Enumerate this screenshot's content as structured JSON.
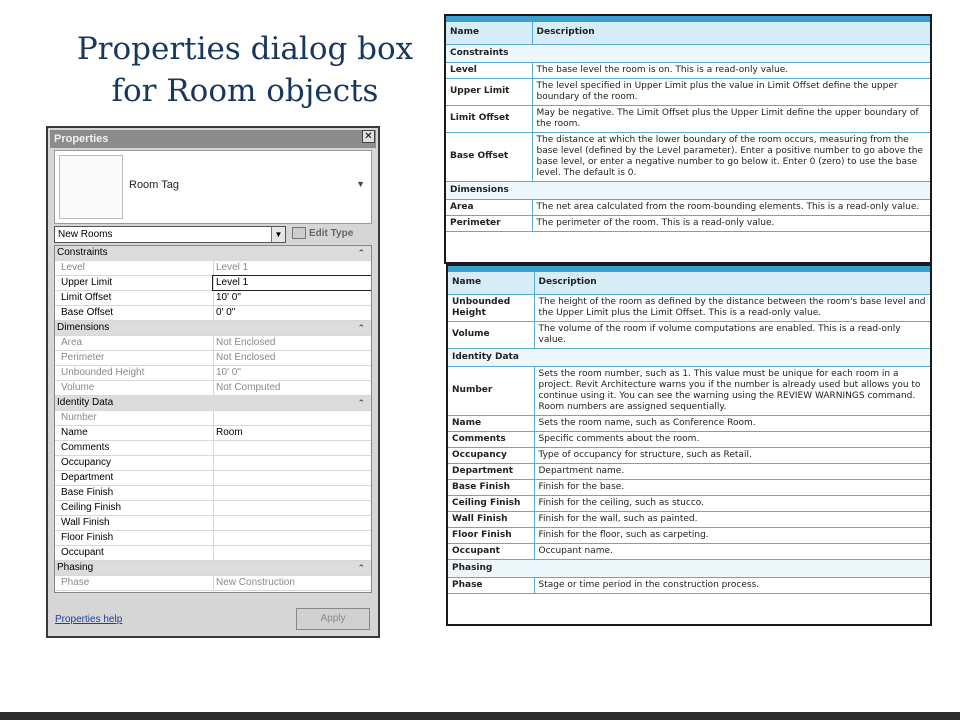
{
  "slide": {
    "title": "Properties dialog box for Room objects"
  },
  "dialog": {
    "title": "Properties",
    "close": "✕",
    "type_name": "Room Tag",
    "selector_value": "New Rooms",
    "edit_type": "Edit Type",
    "help_link": "Properties help",
    "apply": "Apply",
    "rows": [
      {
        "kind": "section",
        "label": "Constraints"
      },
      {
        "kind": "prop",
        "label": "Level",
        "value": "Level 1",
        "readonly": true
      },
      {
        "kind": "prop",
        "label": "Upper Limit",
        "value": "Level 1",
        "selected": true
      },
      {
        "kind": "prop",
        "label": "Limit Offset",
        "value": "10'  0\""
      },
      {
        "kind": "prop",
        "label": "Base Offset",
        "value": "0'  0\""
      },
      {
        "kind": "section",
        "label": "Dimensions"
      },
      {
        "kind": "prop",
        "label": "Area",
        "value": "Not Enclosed",
        "readonly": true
      },
      {
        "kind": "prop",
        "label": "Perimeter",
        "value": "Not Enclosed",
        "readonly": true
      },
      {
        "kind": "prop",
        "label": "Unbounded Height",
        "value": "10'  0\"",
        "readonly": true
      },
      {
        "kind": "prop",
        "label": "Volume",
        "value": "Not Computed",
        "readonly": true
      },
      {
        "kind": "section",
        "label": "Identity Data"
      },
      {
        "kind": "prop",
        "label": "Number",
        "value": "",
        "readonly": true
      },
      {
        "kind": "prop",
        "label": "Name",
        "value": "Room"
      },
      {
        "kind": "prop",
        "label": "Comments",
        "value": ""
      },
      {
        "kind": "prop",
        "label": "Occupancy",
        "value": ""
      },
      {
        "kind": "prop",
        "label": "Department",
        "value": ""
      },
      {
        "kind": "prop",
        "label": "Base Finish",
        "value": ""
      },
      {
        "kind": "prop",
        "label": "Ceiling Finish",
        "value": ""
      },
      {
        "kind": "prop",
        "label": "Wall Finish",
        "value": ""
      },
      {
        "kind": "prop",
        "label": "Floor Finish",
        "value": ""
      },
      {
        "kind": "prop",
        "label": "Occupant",
        "value": ""
      },
      {
        "kind": "section",
        "label": "Phasing"
      },
      {
        "kind": "prop",
        "label": "Phase",
        "value": "New Construction",
        "readonly": true
      }
    ]
  },
  "table1": {
    "headers": [
      "Name",
      "Description"
    ],
    "rows": [
      {
        "kind": "sub",
        "name": "Constraints"
      },
      {
        "name": "Level",
        "desc": "The base level the room is on. This is a read-only value."
      },
      {
        "name": "Upper Limit",
        "desc": "The level specified in Upper Limit plus the value in Limit Offset define the upper boundary of the room."
      },
      {
        "name": "Limit Offset",
        "desc": "May be negative. The Limit Offset plus the Upper Limit define the upper boundary of the room."
      },
      {
        "name": "Base Offset",
        "desc": "The distance at which the lower boundary of the room occurs, measuring from the base level (defined by the Level parameter). Enter a positive number to go above the base level, or enter a negative number to go below it. Enter 0 (zero) to use the base level. The default is 0."
      },
      {
        "kind": "sub",
        "name": "Dimensions"
      },
      {
        "name": "Area",
        "desc": "The net area calculated from the room-bounding elements. This is a read-only value."
      },
      {
        "name": "Perimeter",
        "desc": "The perimeter of the room. This is a read-only value."
      }
    ]
  },
  "table2": {
    "headers": [
      "Name",
      "Description"
    ],
    "rows": [
      {
        "name": "Unbounded Height",
        "desc": "The height of the room as defined by the distance between the room's base level and the Upper Limit plus the Limit Offset. This is a read-only value."
      },
      {
        "name": "Volume",
        "desc": "The volume of the room if volume computations are enabled. This is a read-only value."
      },
      {
        "kind": "sub",
        "name": "Identity Data"
      },
      {
        "name": "Number",
        "desc": "Sets the room number, such as 1. This value must be unique for each room in a project. Revit Architecture warns you if the number is already used but allows you to continue using it. You can see the warning using the REVIEW WARNINGS command. Room numbers are assigned sequentially."
      },
      {
        "name": "Name",
        "desc": "Sets the room name, such as Conference Room."
      },
      {
        "name": "Comments",
        "desc": "Specific comments about the room."
      },
      {
        "name": "Occupancy",
        "desc": "Type of occupancy for structure, such as Retail."
      },
      {
        "name": "Department",
        "desc": "Department name."
      },
      {
        "name": "Base Finish",
        "desc": "Finish for the base."
      },
      {
        "name": "Ceiling Finish",
        "desc": "Finish for the ceiling, such as stucco."
      },
      {
        "name": "Wall Finish",
        "desc": "Finish for the wall, such as painted."
      },
      {
        "name": "Floor Finish",
        "desc": "Finish for the floor, such as carpeting."
      },
      {
        "name": "Occupant",
        "desc": "Occupant name."
      },
      {
        "kind": "sub",
        "name": "Phasing"
      },
      {
        "name": "Phase",
        "desc": "Stage or time period in the construction process."
      }
    ]
  }
}
